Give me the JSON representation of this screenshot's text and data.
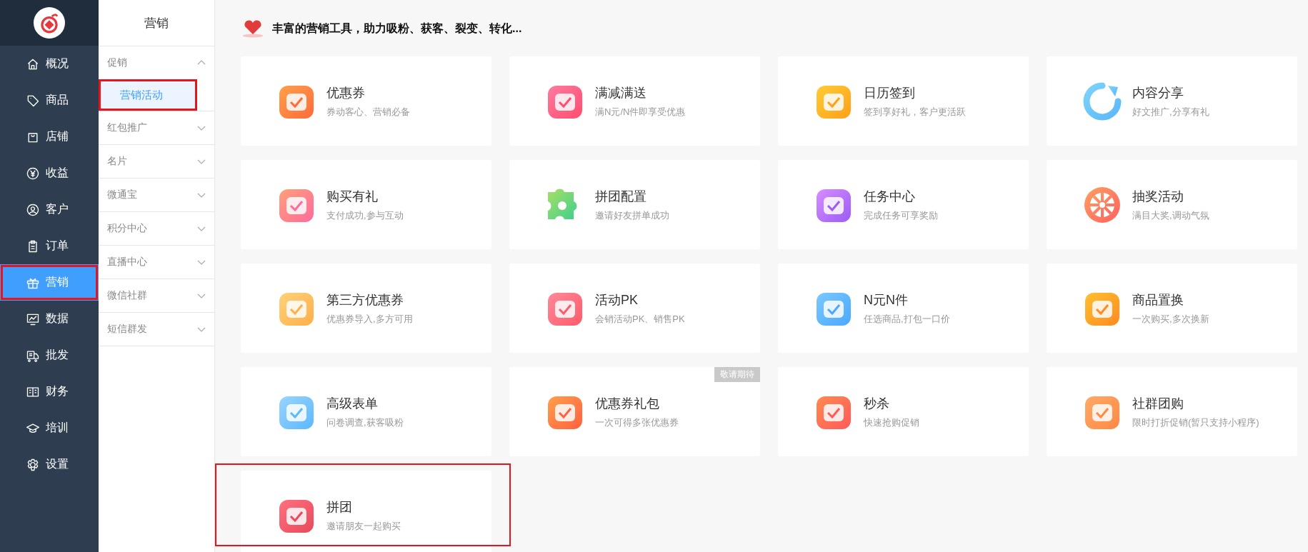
{
  "nav": {
    "items": [
      {
        "label": "概况",
        "selected": false,
        "highlighted": false
      },
      {
        "label": "商品",
        "selected": false,
        "highlighted": false
      },
      {
        "label": "店铺",
        "selected": false,
        "highlighted": false
      },
      {
        "label": "收益",
        "selected": false,
        "highlighted": false
      },
      {
        "label": "客户",
        "selected": false,
        "highlighted": false
      },
      {
        "label": "订单",
        "selected": false,
        "highlighted": false
      },
      {
        "label": "营销",
        "selected": true,
        "highlighted": true
      },
      {
        "label": "数据",
        "selected": false,
        "highlighted": false
      },
      {
        "label": "批发",
        "selected": false,
        "highlighted": false
      },
      {
        "label": "财务",
        "selected": false,
        "highlighted": false
      },
      {
        "label": "培训",
        "selected": false,
        "highlighted": false
      },
      {
        "label": "设置",
        "selected": false,
        "highlighted": false
      }
    ]
  },
  "submenu": {
    "title": "营销",
    "groups": [
      {
        "label": "促销",
        "expanded": true,
        "children": [
          {
            "label": "营销活动",
            "selected": true,
            "highlighted": true
          }
        ]
      },
      {
        "label": "红包推广",
        "expanded": false
      },
      {
        "label": "名片",
        "expanded": false
      },
      {
        "label": "微通宝",
        "expanded": false
      },
      {
        "label": "积分中心",
        "expanded": false
      },
      {
        "label": "直播中心",
        "expanded": false
      },
      {
        "label": "微信社群",
        "expanded": false
      },
      {
        "label": "短信群发",
        "expanded": false
      }
    ]
  },
  "main": {
    "heading": "丰富的营销工具，助力吸粉、获客、裂变、转化...",
    "tools": [
      {
        "title": "优惠券",
        "subtitle": "券动客心、营销必备",
        "highlighted": false
      },
      {
        "title": "满减满送",
        "subtitle": "满N元/N件即享受优惠",
        "highlighted": false
      },
      {
        "title": "日历签到",
        "subtitle": "签到享好礼，客户更活跃",
        "highlighted": false
      },
      {
        "title": "内容分享",
        "subtitle": "好文推广,分享有礼",
        "highlighted": false
      },
      {
        "title": "购买有礼",
        "subtitle": "支付成功,参与互动",
        "highlighted": false
      },
      {
        "title": "拼团配置",
        "subtitle": "邀请好友拼单成功",
        "highlighted": false
      },
      {
        "title": "任务中心",
        "subtitle": "完成任务可享奖励",
        "highlighted": false
      },
      {
        "title": "抽奖活动",
        "subtitle": "满目大奖,调动气氛",
        "highlighted": false
      },
      {
        "title": "第三方优惠券",
        "subtitle": "优惠券导入,多方可用",
        "highlighted": false
      },
      {
        "title": "活动PK",
        "subtitle": "会销活动PK、销售PK",
        "highlighted": false
      },
      {
        "title": "N元N件",
        "subtitle": "任选商品,打包一口价",
        "highlighted": false
      },
      {
        "title": "商品置换",
        "subtitle": "一次购买,多次换新",
        "highlighted": false
      },
      {
        "title": "高级表单",
        "subtitle": "问卷调查,获客吸粉",
        "highlighted": false
      },
      {
        "title": "优惠券礼包",
        "subtitle": "一次可得多张优惠券",
        "badge": "敬请期待",
        "highlighted": false
      },
      {
        "title": "秒杀",
        "subtitle": "快速抢购促销",
        "highlighted": false
      },
      {
        "title": "社群团购",
        "subtitle": "限时打折促销(暂只支持小程序)",
        "highlighted": false
      },
      {
        "title": "拼团",
        "subtitle": "邀请朋友一起购买",
        "highlighted": true
      }
    ]
  }
}
